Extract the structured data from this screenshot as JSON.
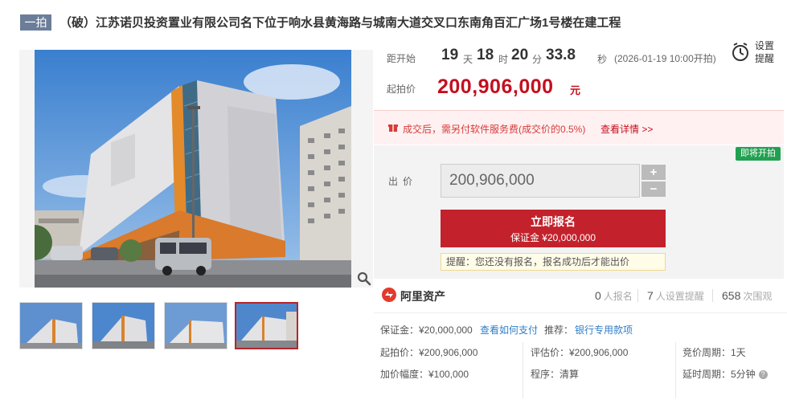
{
  "header": {
    "round_badge": "一拍",
    "title": "（破）江苏诺贝投资置业有限公司名下位于响水县黄海路与城南大道交叉口东南角百汇广场1号楼在建工程"
  },
  "countdown": {
    "label": "距开始",
    "days": "19",
    "days_unit": "天",
    "hours": "18",
    "hours_unit": "时",
    "minutes": "20",
    "minutes_unit": "分",
    "seconds": "33.8",
    "seconds_unit": "秒",
    "start_time": "(2026-01-19 10:00开拍)"
  },
  "reminder": {
    "icon": "alarm-clock-icon",
    "label": "设置提醒"
  },
  "start_price": {
    "label": "起拍价",
    "value": "200,906,000",
    "unit": "元"
  },
  "notice": {
    "text": "成交后，需另付软件服务费(成交价的0.5%)",
    "link": "查看详情 >>"
  },
  "bid": {
    "status_badge": "即将开拍",
    "label": "出价",
    "value": "200,906,000",
    "plus": "+",
    "minus": "−",
    "signup_main": "立即报名",
    "signup_sub": "保证金 ¥20,000,000",
    "tip": "提醒：您还没有报名，报名成功后才能出价"
  },
  "brand": {
    "name": "阿里资产",
    "signups": "0",
    "signups_unit": "人报名",
    "reminders": "7",
    "reminders_unit": "人设置提醒",
    "views": "658",
    "views_unit": "次围观"
  },
  "details": {
    "deposit": "保证金：¥20,000,000",
    "how_to_pay": "查看如何支付",
    "recommend_label": "推荐：",
    "recommend_link": "银行专用款项",
    "start_price": "起拍价：¥200,906,000",
    "appraisal": "评估价：¥200,906,000",
    "cycle": "竞价周期：1天",
    "increment": "加价幅度：¥100,000",
    "procedure": "程序：清算",
    "extension": "延时周期：5分钟",
    "help": "?"
  },
  "colors": {
    "accent_red": "#c3222c",
    "price_red": "#c3101f",
    "badge_green": "#22a051",
    "round_badge": "#6b7d98"
  }
}
